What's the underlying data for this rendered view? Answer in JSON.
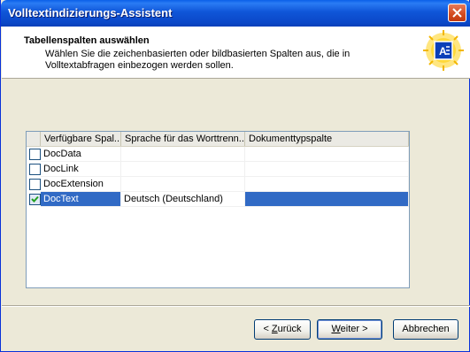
{
  "window": {
    "title": "Volltextindizierungs-Assistent"
  },
  "header": {
    "title": "Tabellenspalten auswählen",
    "description": "Wählen Sie die zeichenbasierten oder bildbasierten Spalten aus, die in Volltextabfragen einbezogen werden sollen."
  },
  "table": {
    "columns": [
      "Verfügbare Spal...",
      "Sprache für das Worttrenn...",
      "Dokumenttypspalte"
    ],
    "rows": [
      {
        "checked": false,
        "name": "DocData",
        "language": "",
        "doctype": ""
      },
      {
        "checked": false,
        "name": "DocLink",
        "language": "",
        "doctype": ""
      },
      {
        "checked": false,
        "name": "DocExtension",
        "language": "",
        "doctype": ""
      },
      {
        "checked": true,
        "name": "DocText",
        "language": "Deutsch (Deutschland)",
        "doctype": ""
      }
    ]
  },
  "buttons": {
    "back_prefix": "< ",
    "back_key": "Z",
    "back_rest": "urück",
    "next_key": "W",
    "next_rest": "eiter >",
    "cancel": "Abbrechen"
  },
  "colors": {
    "title_bar": "#0A5FE8",
    "selection": "#316AC5",
    "dialog_bg": "#ECE9D8"
  },
  "icons": {
    "close": "close-icon",
    "wizard": "wizard-document-icon",
    "checkbox": "checkbox-icon"
  }
}
